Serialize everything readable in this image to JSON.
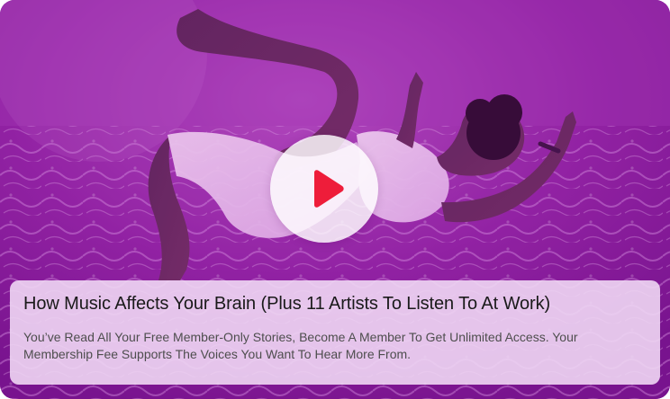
{
  "card": {
    "title": "How Music Affects Your Brain (Plus 11 Artists To Listen To At Work)",
    "description": "You’ve Read All Your Free Member-Only Stories, Become A Member To Get Unlimited Access. Your Membership Fee Supports The Voices You Want To Hear More From."
  },
  "media": {
    "play_icon": "play-icon",
    "colors": {
      "background_magenta": "#8d1aa0",
      "play_accent": "#ee1d3a",
      "panel": "#f0d7f4"
    }
  }
}
